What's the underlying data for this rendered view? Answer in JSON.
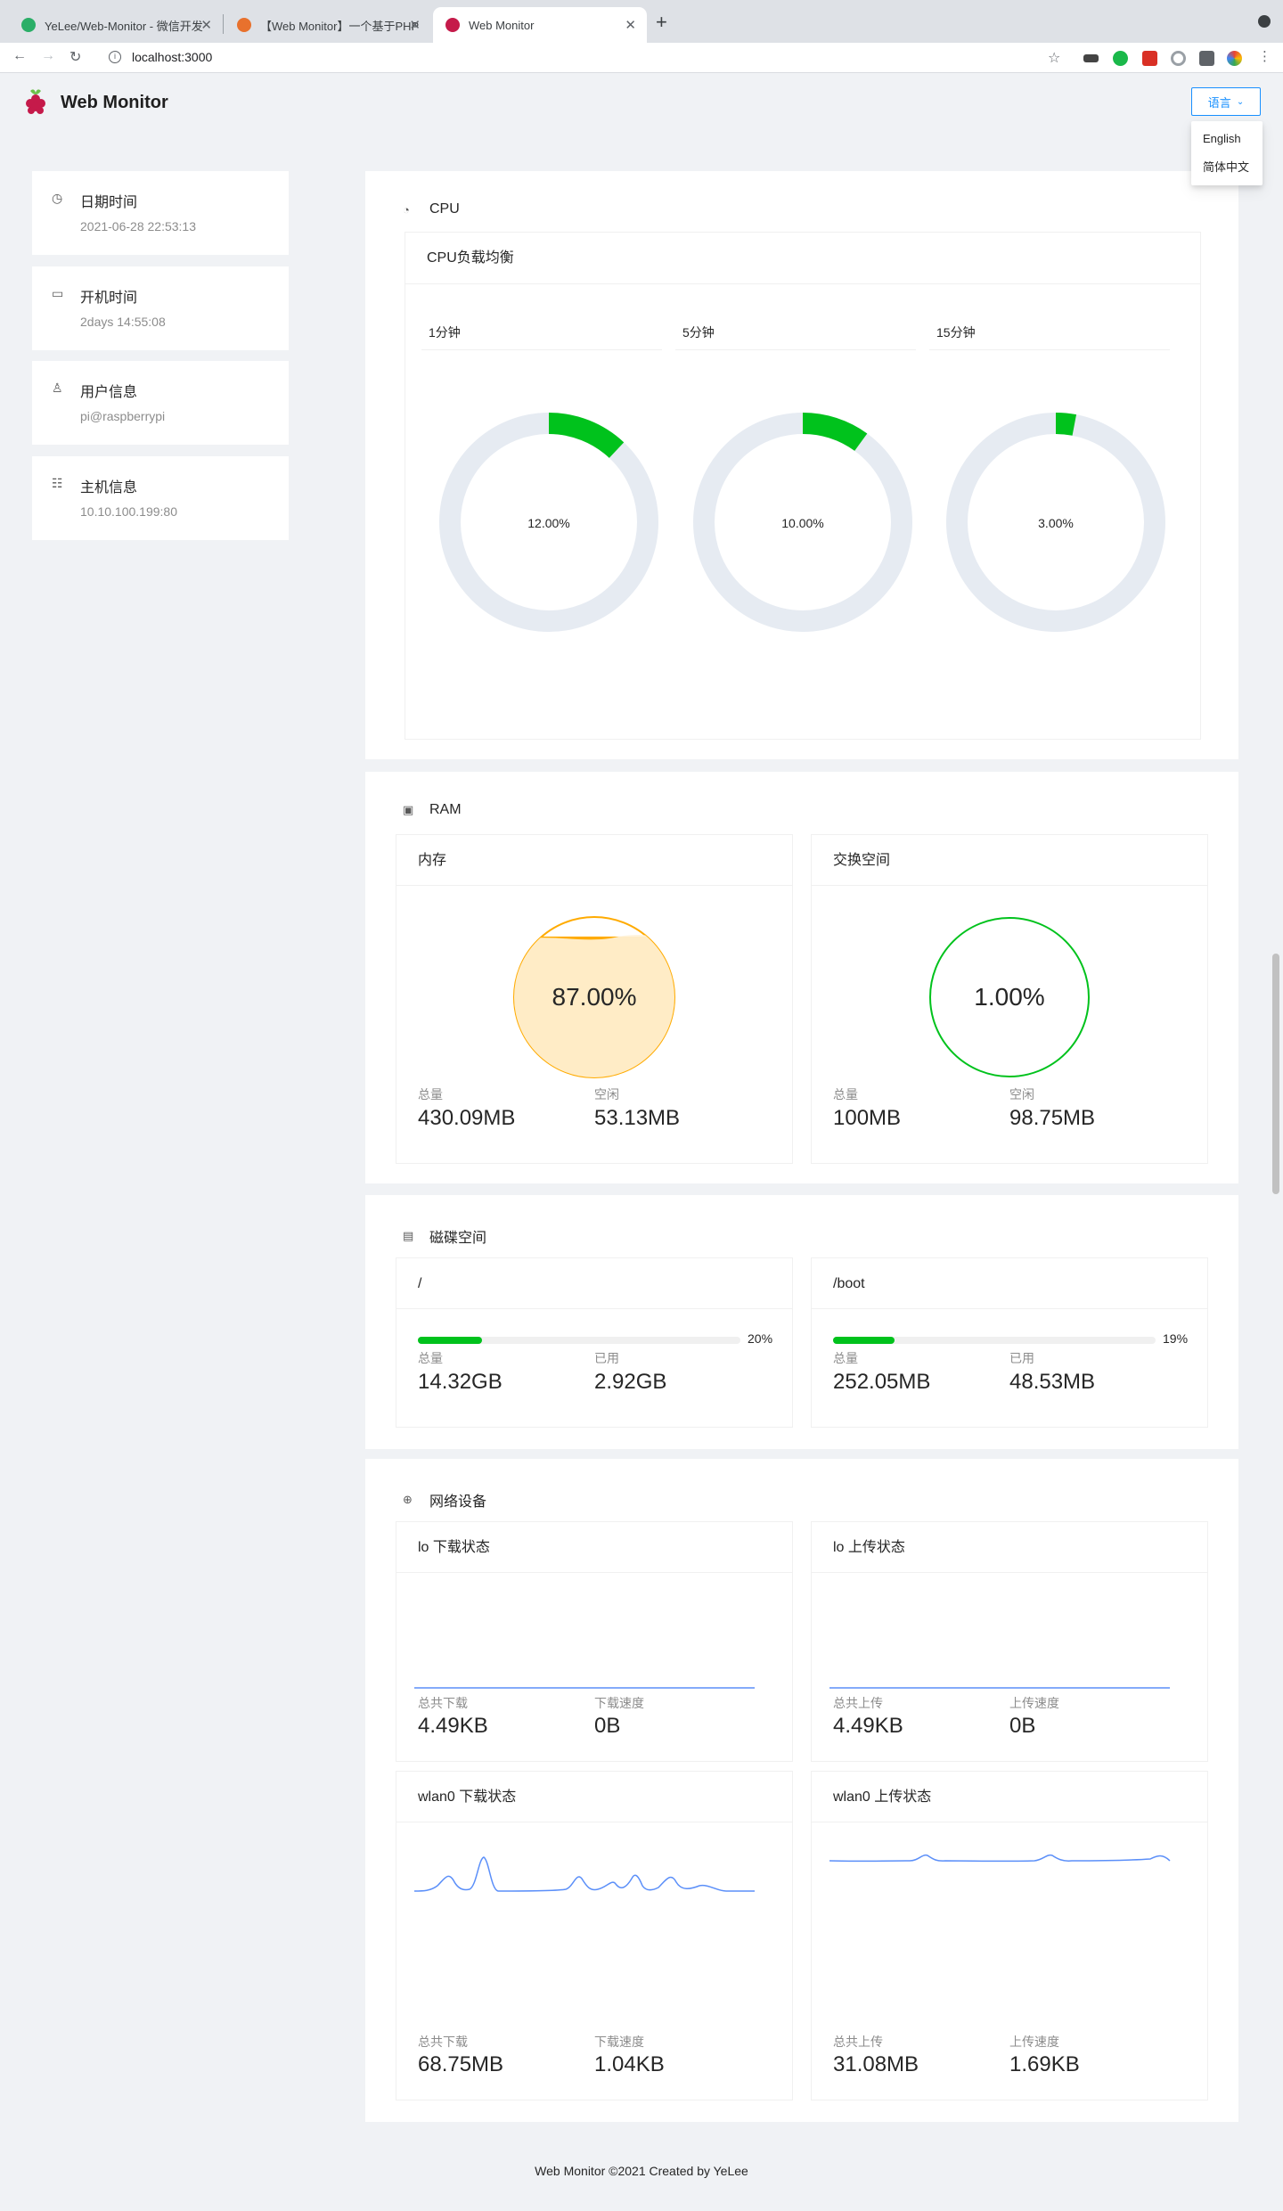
{
  "browser": {
    "tabs": [
      {
        "label": "YeLee/Web-Monitor - 微信开发",
        "favicon_color": "#2aae67"
      },
      {
        "label": "【Web Monitor】一个基于PHP",
        "favicon_color": "#e8712d"
      },
      {
        "label": "Web Monitor",
        "favicon_color": "#c51a4a"
      }
    ],
    "url": "localhost:3000"
  },
  "app": {
    "title": "Web Monitor",
    "language_button": "语言",
    "language_options": [
      "English",
      "简体中文"
    ]
  },
  "sidebar": [
    {
      "icon": "clock-icon",
      "title": "日期时间",
      "value": "2021-06-28 22:53:13"
    },
    {
      "icon": "monitor-icon",
      "title": "开机时间",
      "value": "2days 14:55:08"
    },
    {
      "icon": "user-icon",
      "title": "用户信息",
      "value": "pi@raspberrypi"
    },
    {
      "icon": "server-icon",
      "title": "主机信息",
      "value": "10.10.100.199:80"
    }
  ],
  "cpu": {
    "title": "CPU",
    "card_title": "CPU负载均衡",
    "loads": [
      {
        "label": "1分钟",
        "value_text": "12.00%",
        "value": 12
      },
      {
        "label": "5分钟",
        "value_text": "10.00%",
        "value": 10
      },
      {
        "label": "15分钟",
        "value_text": "3.00%",
        "value": 3
      }
    ],
    "colors": {
      "fill": "#00c21c",
      "track": "#e6ebf2"
    }
  },
  "ram": {
    "title": "RAM",
    "memory": {
      "title": "内存",
      "percent_text": "87.00%",
      "percent": 87,
      "total_label": "总量",
      "total": "430.09MB",
      "free_label": "空闲",
      "free": "53.13MB",
      "color": "#ffab00"
    },
    "swap": {
      "title": "交换空间",
      "percent_text": "1.00%",
      "percent": 1,
      "total_label": "总量",
      "total": "100MB",
      "free_label": "空闲",
      "free": "98.75MB",
      "color": "#00c21c"
    }
  },
  "disk": {
    "title": "磁碟空间",
    "items": [
      {
        "title": "/",
        "percent_text": "20%",
        "percent": 20,
        "total_label": "总量",
        "total": "14.32GB",
        "used_label": "已用",
        "used": "2.92GB"
      },
      {
        "title": "/boot",
        "percent_text": "19%",
        "percent": 19,
        "total_label": "总量",
        "total": "252.05MB",
        "used_label": "已用",
        "used": "48.53MB"
      }
    ]
  },
  "network": {
    "title": "网络设备",
    "cards": [
      {
        "title": "lo 下载状态",
        "total_label": "总共下载",
        "total": "4.49KB",
        "speed_label": "下载速度",
        "speed": "0B"
      },
      {
        "title": "lo 上传状态",
        "total_label": "总共上传",
        "total": "4.49KB",
        "speed_label": "上传速度",
        "speed": "0B"
      },
      {
        "title": "wlan0 下载状态",
        "total_label": "总共下载",
        "total": "68.75MB",
        "speed_label": "下载速度",
        "speed": "1.04KB"
      },
      {
        "title": "wlan0 上传状态",
        "total_label": "总共上传",
        "total": "31.08MB",
        "speed_label": "上传速度",
        "speed": "1.69KB"
      }
    ],
    "line_color": "#5b8ff9"
  },
  "footer": "Web Monitor ©2021 Created by YeLee"
}
